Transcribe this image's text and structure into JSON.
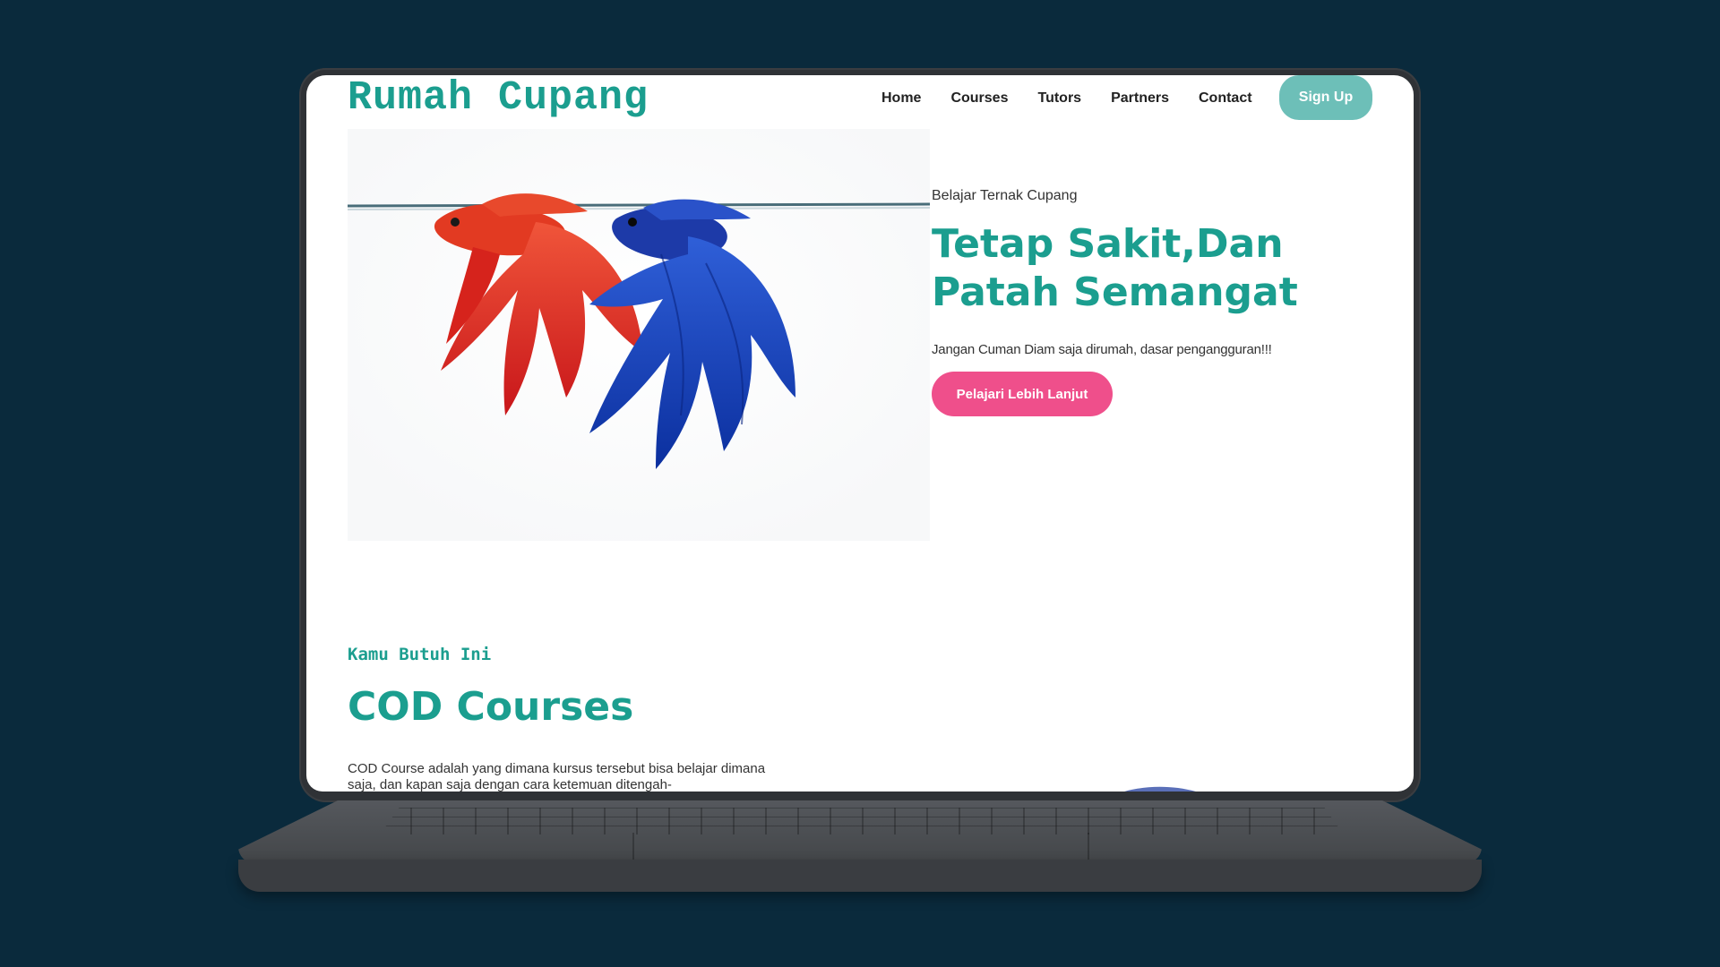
{
  "site": {
    "logo": "Rumah Cupang",
    "nav": [
      "Home",
      "Courses",
      "Tutors",
      "Partners",
      "Contact"
    ],
    "signup_label": "Sign Up"
  },
  "hero": {
    "kicker": "Belajar Ternak Cupang",
    "title": "Tetap Sakit,Dan Patah Semangat",
    "subtitle": "Jangan Cuman Diam saja dirumah, dasar pengangguran!!!",
    "cta_label": "Pelajari Lebih Lanjut"
  },
  "section": {
    "kicker": "Kamu Butuh Ini",
    "title": "COD Courses",
    "body": "COD Course adalah yang dimana kursus tersebut bisa belajar dimana saja, dan kapan saja dengan cara ketemuan ditengah-"
  },
  "colors": {
    "background": "#0a2a3c",
    "accent": "#1b9e8f",
    "signup": "#6dbfb8",
    "cta": "#ef4f8b"
  }
}
